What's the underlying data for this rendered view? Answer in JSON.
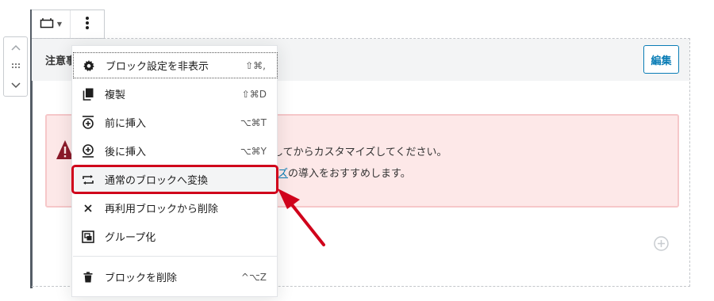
{
  "mover": {
    "up_icon": "chevron-up-icon",
    "drag_icon": "drag-handle-icon",
    "down_icon": "chevron-down-icon"
  },
  "toolbar": {
    "block_type_icon": "block-type-icon",
    "more_icon": "more-options-icon"
  },
  "block": {
    "title": "注意事",
    "edit_label": "編集"
  },
  "notice": {
    "icon": "warning-icon",
    "line1": "してからカスタマイズしてください。",
    "line2_link": "ズ",
    "line2_rest": "の導入をおすすめします。"
  },
  "menu": {
    "items": [
      {
        "label": "ブロック設定を非表示",
        "shortcut": "⇧⌘,",
        "icon": "gear-icon"
      },
      {
        "label": "複製",
        "shortcut": "⇧⌘D",
        "icon": "duplicate-icon"
      },
      {
        "label": "前に挿入",
        "shortcut": "⌥⌘T",
        "icon": "insert-before-icon"
      },
      {
        "label": "後に挿入",
        "shortcut": "⌥⌘Y",
        "icon": "insert-after-icon"
      },
      {
        "label": "通常のブロックへ変換",
        "shortcut": "",
        "icon": "convert-icon"
      },
      {
        "label": "再利用ブロックから削除",
        "shortcut": "",
        "icon": "close-icon"
      },
      {
        "label": "グループ化",
        "shortcut": "",
        "icon": "group-icon"
      },
      {
        "label": "ブロックを削除",
        "shortcut": "^⌥Z",
        "icon": "trash-icon"
      }
    ]
  },
  "annotation": {
    "color": "#d0021b"
  },
  "colors": {
    "link": "#0a7db6",
    "notice_bg": "#fde8e8",
    "warning": "#8b1a2a"
  }
}
